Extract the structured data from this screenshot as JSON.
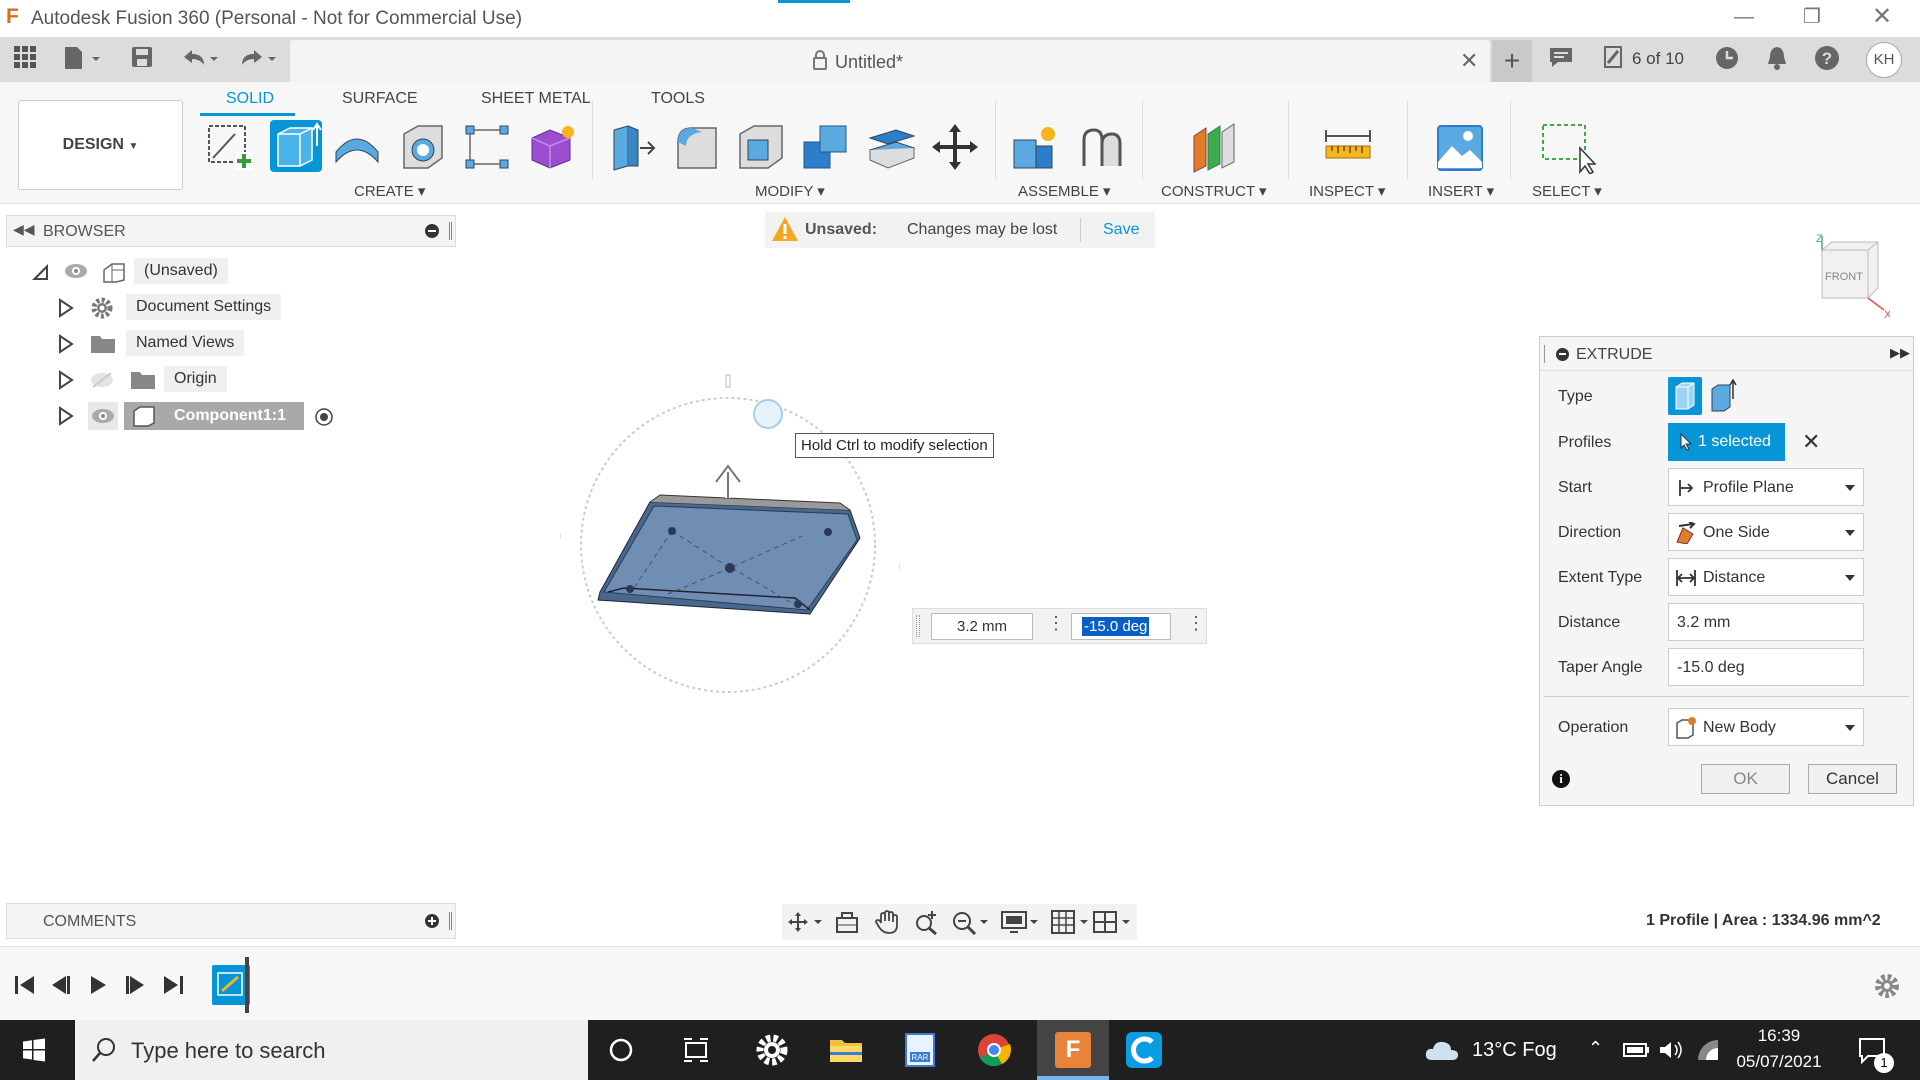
{
  "window": {
    "title": "Autodesk Fusion 360 (Personal - Not for Commercial Use)",
    "logo_letter": "F"
  },
  "app_toolbar": {
    "doc_title": "Untitled*",
    "version_label": "6 of 10",
    "user_initials": "KH"
  },
  "ribbon": {
    "tabs": [
      "SOLID",
      "SURFACE",
      "SHEET METAL",
      "TOOLS"
    ],
    "design_label": "DESIGN",
    "groups": {
      "create": "CREATE",
      "modify": "MODIFY",
      "assemble": "ASSEMBLE",
      "construct": "CONSTRUCT",
      "inspect": "INSPECT",
      "insert": "INSERT",
      "select": "SELECT"
    }
  },
  "browser": {
    "title": "BROWSER",
    "items": [
      {
        "label": "(Unsaved)"
      },
      {
        "label": "Document Settings"
      },
      {
        "label": "Named Views"
      },
      {
        "label": "Origin"
      },
      {
        "label": "Component1:1"
      }
    ]
  },
  "unsaved_bar": {
    "status": "Unsaved:",
    "message": "Changes may be lost",
    "save_label": "Save"
  },
  "viewport": {
    "tooltip": "Hold Ctrl to modify selection",
    "distance_value": "3.2 mm",
    "angle_value": "-15.0 deg",
    "viewcube_face": "FRONT",
    "axis_z": "Z",
    "axis_x": "X",
    "status_info": "1 Profile | Area : 1334.96 mm^2"
  },
  "extrude": {
    "title": "EXTRUDE",
    "labels": {
      "type": "Type",
      "profiles": "Profiles",
      "start": "Start",
      "direction": "Direction",
      "extent_type": "Extent Type",
      "distance": "Distance",
      "taper_angle": "Taper Angle",
      "operation": "Operation"
    },
    "values": {
      "profiles": "1 selected",
      "start": "Profile Plane",
      "direction": "One Side",
      "extent_type": "Distance",
      "distance": "3.2 mm",
      "taper_angle": "-15.0 deg",
      "operation": "New Body"
    },
    "ok_label": "OK",
    "cancel_label": "Cancel"
  },
  "comments": {
    "title": "COMMENTS"
  },
  "taskbar": {
    "search_placeholder": "Type here to search",
    "weather": "13°C  Fog",
    "time": "16:39",
    "date": "05/07/2021",
    "notification_count": "1"
  },
  "colors": {
    "accent": "#0696d7",
    "selected_blue": "#0a84c9",
    "body_blue": "#6c8aab",
    "taskbar": "#1f1f1f"
  }
}
